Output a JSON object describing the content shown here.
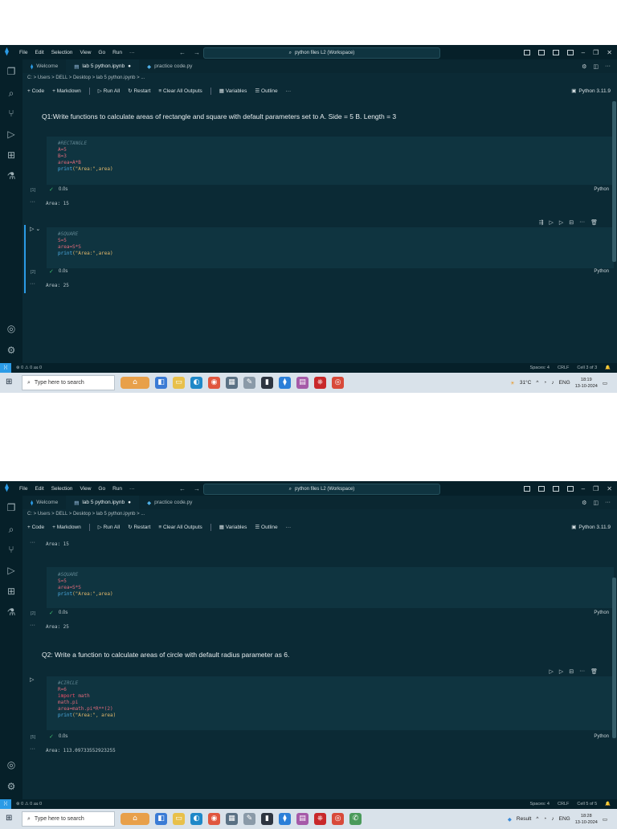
{
  "window": {
    "menu": [
      "File",
      "Edit",
      "Selection",
      "View",
      "Go",
      "Run",
      "···"
    ],
    "command_center": "python files L2 (Workspace)",
    "controls": [
      "–",
      "❐",
      "✕"
    ]
  },
  "tabs": [
    {
      "label": "Welcome"
    },
    {
      "label": "lab 5 python.ipynb",
      "dirty": "●"
    },
    {
      "label": "practice code.py"
    }
  ],
  "breadcrumb": "C: > Users > DELL > Desktop > lab 5 python.ipynb > ...",
  "toolbar": {
    "code": "+ Code",
    "markdown": "+ Markdown",
    "run_all": "Run All",
    "restart": "Restart",
    "clear": "Clear All Outputs",
    "variables": "Variables",
    "outline": "Outline",
    "more": "···",
    "kernel": "Python 3.11.9"
  },
  "shot1": {
    "q1": "Q1:Write functions to calculate areas of rectangle and square with default parameters set to A. Side = 5 B. Length = 3",
    "cell1": {
      "lines": [
        {
          "t": "#RECTANGLE",
          "c": "cmt"
        },
        {
          "t": "A=5",
          "c": "var"
        },
        {
          "t": "B=3",
          "c": "var"
        },
        {
          "t": "area=A*B",
          "c": "var"
        }
      ],
      "print_fn": "print",
      "print_args": "(\"Area:\",area)",
      "count": "[1]",
      "time": "0.0s",
      "lang": "Python",
      "output": "Area: 15"
    },
    "cell2": {
      "lines": [
        {
          "t": "#SQUARE",
          "c": "cmt"
        },
        {
          "t": "S=5",
          "c": "var"
        },
        {
          "t": "area=S*S",
          "c": "var"
        }
      ],
      "print_fn": "print",
      "print_args": "(\"Area:\",area)",
      "count": "[2]",
      "time": "0.0s",
      "lang": "Python",
      "output": "Area: 25"
    },
    "status_left": "⊗ 0 ⚠ 0   ⅏ 0",
    "status_right": [
      "Spaces: 4",
      "CRLF",
      "Cell 3 of 3"
    ],
    "clock_time": "18:19",
    "clock_date": "13-10-2024"
  },
  "shot2": {
    "top_output": "Area: 15",
    "cell2": {
      "lines": [
        {
          "t": "#SQUARE",
          "c": "cmt"
        },
        {
          "t": "S=5",
          "c": "var"
        },
        {
          "t": "area=S*S",
          "c": "var"
        }
      ],
      "print_fn": "print",
      "print_args": "(\"Area:\",area)",
      "count": "[2]",
      "time": "0.0s",
      "lang": "Python",
      "output": "Area: 25"
    },
    "q2": "Q2: Write a function to calculate areas of circle with default radius parameter as 6.",
    "cell3": {
      "comment": "#CIRCLE",
      "l1": "R=6",
      "import_kw": "import",
      "import_mod": "math",
      "l3": "math.pi",
      "l4": "area=math.pi*R**(2)",
      "print_fn": "print",
      "print_args": "(\"Area:\", area)",
      "count": "[5]",
      "time": "0.0s",
      "lang": "Python",
      "output": "Area: 113.09733552923255"
    },
    "status_left": "⊗ 0 ⚠ 0   ⅏ 0",
    "status_right": [
      "Spaces: 4",
      "CRLF",
      "Cell 5 of 5"
    ],
    "clock_time": "18:28",
    "clock_date": "13-10-2024",
    "result_app": "Result"
  },
  "taskbar": {
    "search_placeholder": "Type here to search",
    "weather": "31°C",
    "lang": "ENG"
  }
}
